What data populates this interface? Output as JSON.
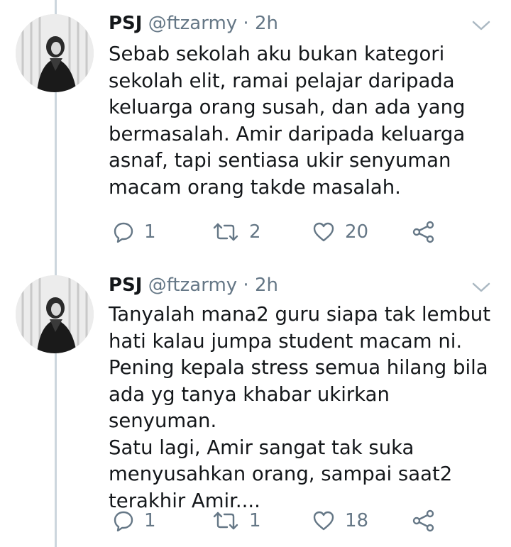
{
  "tweets": [
    {
      "name": "PSJ",
      "handle": "@ftzarmy",
      "separator": "·",
      "time": "2h",
      "text": "Sebab sekolah aku bukan kategori\nsekolah elit, ramai pelajar daripada\nkeluarga orang susah, dan ada yang\nbermasalah. Amir daripada keluarga\nasnaf, tapi sentiasa ukir senyuman\nmacam orang takde masalah.",
      "replies": "1",
      "retweets": "2",
      "likes": "20"
    },
    {
      "name": "PSJ",
      "handle": "@ftzarmy",
      "separator": "·",
      "time": "2h",
      "text": "Tanyalah mana2 guru siapa tak lembut\nhati kalau jumpa student macam ni.\nPening kepala stress semua hilang bila\nada yg tanya khabar ukirkan senyuman.\nSatu lagi, Amir sangat tak suka\nmenyusahkan orang, sampai saat2\nterakhir Amir....",
      "replies": "1",
      "retweets": "1",
      "likes": "18"
    }
  ],
  "icons": {
    "reply": "reply-icon",
    "retweet": "retweet-icon",
    "like": "heart-icon",
    "share": "share-icon",
    "menu": "chevron-down-icon"
  },
  "colors": {
    "text": "#14171a",
    "secondary": "#657786",
    "thread_line": "#ccd6dd"
  }
}
